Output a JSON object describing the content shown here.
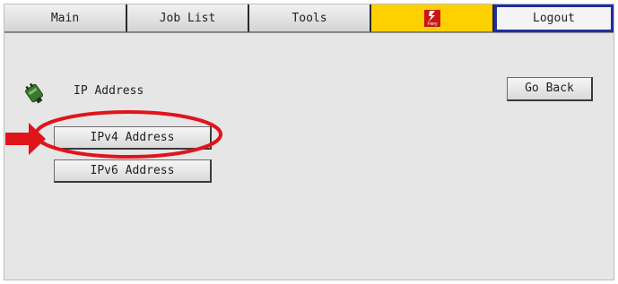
{
  "tabs": {
    "main": "Main",
    "job_list": "Job List",
    "tools": "Tools",
    "brand_logo_text": "Fiery",
    "logout": "Logout"
  },
  "content": {
    "icon": "network-plug-icon",
    "title": "IP Address",
    "go_back": "Go Back",
    "ipv4": "IPv4 Address",
    "ipv6": "IPv6 Address"
  },
  "annotation": {
    "highlight_color": "#e0141b",
    "arrow_color": "#e0141b",
    "target": "ipv4-address-button"
  },
  "colors": {
    "brand_tab": "#ffd000",
    "logout_border": "#1f2fa0",
    "background": "#e6e6e6"
  }
}
